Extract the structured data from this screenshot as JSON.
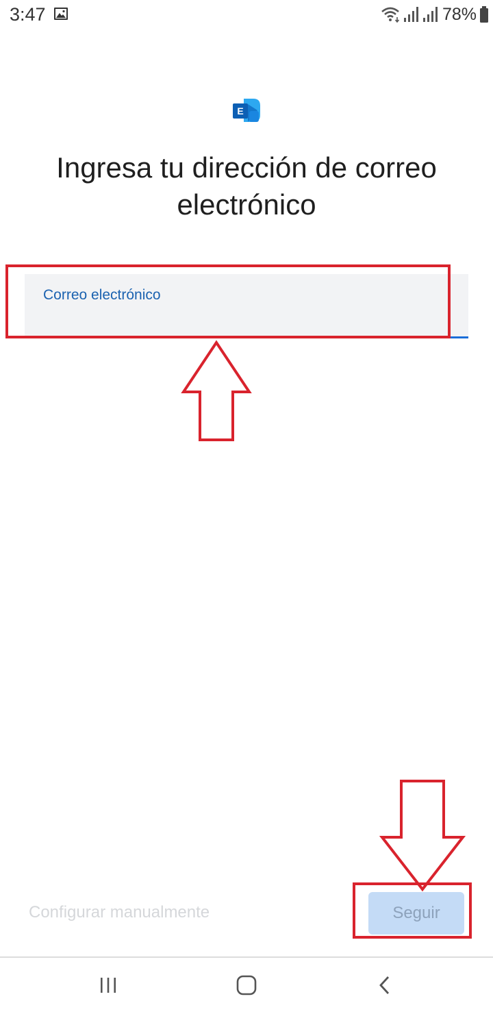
{
  "status_bar": {
    "time": "3:47",
    "battery": "78%",
    "icons": [
      "gallery-icon",
      "wifi-icon",
      "signal-icon",
      "signal-icon",
      "battery-icon"
    ]
  },
  "app": {
    "logo_letter": "E",
    "logo_icon": "exchange-logo-icon"
  },
  "main": {
    "title": "Ingresa tu dirección de correo electrónico",
    "email_field": {
      "label": "Correo electrónico",
      "value": ""
    }
  },
  "actions": {
    "manual_config_label": "Configurar manualmente",
    "continue_label": "Seguir"
  },
  "nav": {
    "icons": [
      "recent-apps-icon",
      "home-icon",
      "back-icon"
    ]
  },
  "colors": {
    "annotation_red": "#d9232d",
    "accent_blue": "#1a6ed8",
    "field_bg": "#f2f3f5",
    "button_disabled_bg": "#c4dbf6"
  }
}
